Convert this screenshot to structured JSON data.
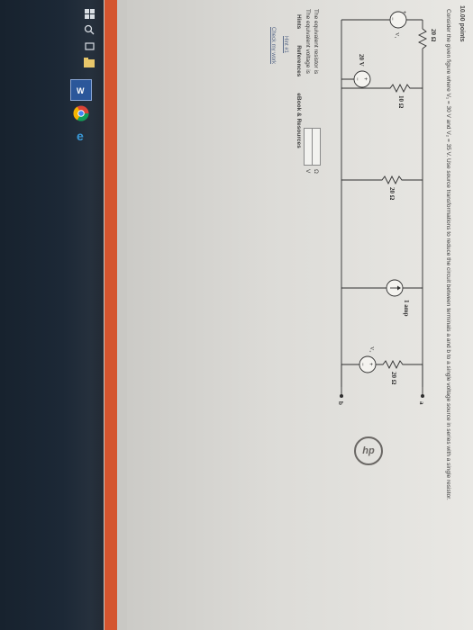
{
  "header": {
    "points": "10.00 points"
  },
  "question": {
    "text": "Consider the given figure where V₁ = 30 V and V₂ = 35 V. Use source transformations to reduce the circuit between terminals a and b to a single voltage source in series with a single resistor."
  },
  "circuit": {
    "r_top": "20 Ω",
    "r_left": "10 Ω",
    "r_mid": "20 Ω",
    "r_right": "20 Ω",
    "v1_label": "V₁",
    "v1_value": "20 V",
    "v2_label": "V₂",
    "current_label": "1 amp",
    "terminal_a": "a",
    "terminal_b": "b",
    "plus": "+",
    "minus": "−"
  },
  "answers": {
    "resistor_label": "The equivalent resistor is",
    "resistor_unit": "Ω",
    "voltage_label": "The equivalent voltage is",
    "voltage_unit": "V"
  },
  "tabs": {
    "hints": "Hints",
    "references": "References",
    "ebook": "eBook & Resources"
  },
  "links": {
    "hint": "Hint #1",
    "check": "Check my work"
  },
  "colors": {
    "accent_bar": "#d4552f",
    "taskbar": "#1c2836",
    "screen_bg": "#e3e2de"
  }
}
